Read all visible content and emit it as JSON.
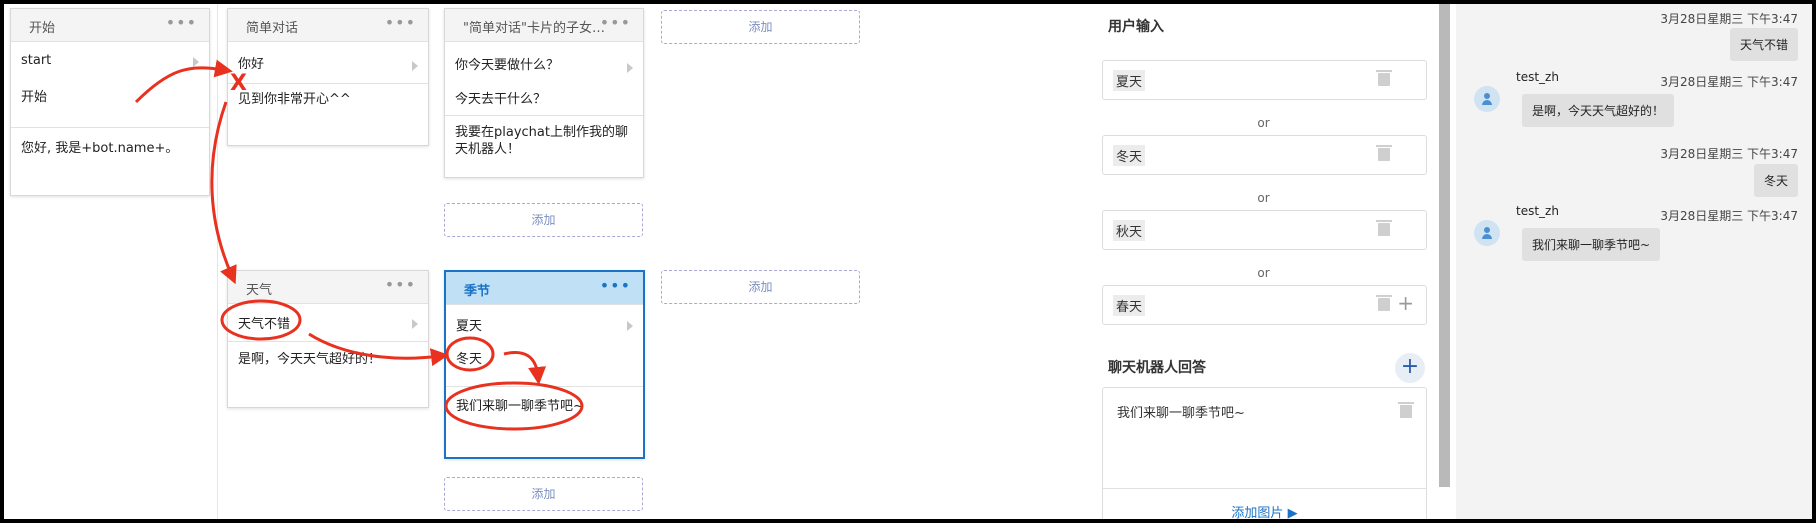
{
  "cards": {
    "start": {
      "title": "开始",
      "items": [
        "start",
        "开始"
      ],
      "response": "您好, 我是+bot.name+。"
    },
    "chat": {
      "title": "简单对话",
      "items": [
        "你好"
      ],
      "response": "见到你非常开心^^"
    },
    "child": {
      "title": "\"简单对话\"卡片的子女…",
      "items": [
        "你今天要做什么？",
        "今天去干什么？"
      ],
      "response": "我要在playchat上制作我的聊天机器人！"
    },
    "weather": {
      "title": "天气",
      "items": [
        "天气不错"
      ],
      "response": "是啊，今天天气超好的！"
    },
    "season": {
      "title": "季节",
      "items": [
        "夏天",
        "冬天"
      ],
      "response": "我们来聊一聊季节吧~"
    }
  },
  "add_label": "添加",
  "annotation_mark": "X",
  "panel": {
    "user_input_title": "用户输入",
    "inputs": [
      "夏天",
      "冬天",
      "秋天",
      "春天"
    ],
    "or_label": "or",
    "bot_answer_title": "聊天机器人回答",
    "answer_text": "我们来聊一聊季节吧~",
    "add_image_label": "添加图片"
  },
  "chat_log": {
    "timestamp": "3月28日星期三 下午3:47",
    "messages": [
      {
        "from": "user",
        "text": "天气不错"
      },
      {
        "from": "bot",
        "name": "test_zh",
        "text": "是啊，今天天气超好的！"
      },
      {
        "from": "user",
        "text": "冬天"
      },
      {
        "from": "bot",
        "name": "test_zh",
        "text": "我们来聊一聊季节吧~"
      }
    ]
  },
  "colors": {
    "accent": "#1b73c8",
    "annotation": "#e8311e",
    "active_header": "#bfe0f5"
  }
}
